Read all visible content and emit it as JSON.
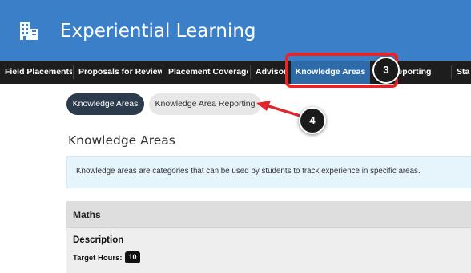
{
  "header": {
    "logo_icon": "building-icon",
    "title": "Experiential Learning",
    "background": "#3a7fc8"
  },
  "nav": {
    "items": [
      {
        "label": "Field Placements"
      },
      {
        "label": "Proposals for Review"
      },
      {
        "label": "Placement Coverage"
      },
      {
        "label": "Advisors"
      },
      {
        "label": "Knowledge Areas",
        "active": true
      },
      {
        "label": "Activity Reporting"
      },
      {
        "label": "Sta"
      }
    ],
    "active_color": "#2f6aa8"
  },
  "annotations": {
    "step3": "3",
    "step4": "4",
    "color": "#e3262c"
  },
  "subtabs": {
    "active": "Knowledge Areas",
    "inactive": "Knowledge Area Reporting"
  },
  "page": {
    "heading": "Knowledge Areas",
    "info": "Knowledge areas are categories that can be used by students to track experience in specific areas."
  },
  "panel": {
    "title": "Maths",
    "description_label": "Description",
    "target_label": "Target Hours:",
    "target_hours": "10"
  }
}
